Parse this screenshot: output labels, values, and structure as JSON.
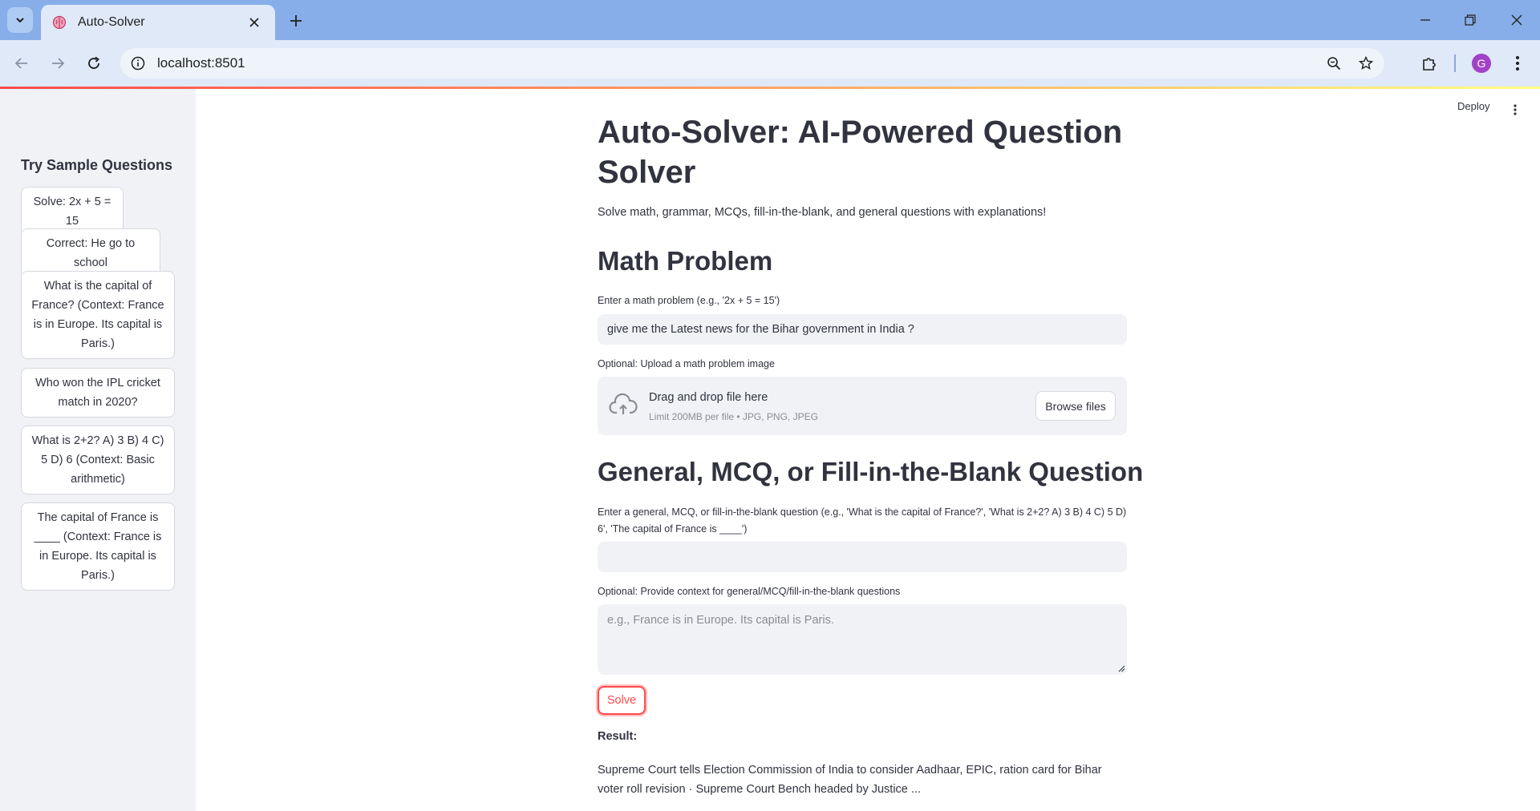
{
  "browser": {
    "tab_title": "Auto-Solver",
    "url": "localhost:8501",
    "profile_initial": "G"
  },
  "app": {
    "deploy_label": "Deploy",
    "sidebar": {
      "heading": "Try Sample Questions",
      "samples": [
        "Solve: 2x + 5 = 15",
        "Correct: He go to school",
        "What is the capital of France? (Context: France is in Europe. Its capital is Paris.)",
        "Who won the IPL cricket match in 2020?",
        "What is 2+2? A) 3 B) 4 C) 5 D) 6 (Context: Basic arithmetic)",
        "The capital of France is ____ (Context: France is in Europe. Its capital is Paris.)"
      ]
    },
    "title": "Auto-Solver: AI-Powered Question Solver",
    "subtitle": "Solve math, grammar, MCQs, fill-in-the-blank, and general questions with explanations!",
    "math": {
      "heading": "Math Problem",
      "input_label": "Enter a math problem (e.g., '2x + 5 = 15')",
      "input_value": "give me the Latest news for the Bihar government in India ?",
      "upload_label": "Optional: Upload a math problem image",
      "upload_title": "Drag and drop file here",
      "upload_limit": "Limit 200MB per file • JPG, PNG, JPEG",
      "browse_label": "Browse files"
    },
    "general": {
      "heading": "General, MCQ, or Fill-in-the-Blank Question",
      "input_label": "Enter a general, MCQ, or fill-in-the-blank question (e.g., 'What is the capital of France?', 'What is 2+2? A) 3 B) 4 C) 5 D) 6', 'The capital of France is ____')",
      "input_value": "",
      "context_label": "Optional: Provide context for general/MCQ/fill-in-the-blank questions",
      "context_placeholder": "e.g., France is in Europe. Its capital is Paris."
    },
    "solve_label": "Solve",
    "result_label": "Result:",
    "result_text": "Supreme Court tells Election Commission of India to consider Aadhaar, EPIC, ration card for Bihar voter roll revision · Supreme Court Bench headed by Justice ..."
  },
  "colors": {
    "accent": "#ff4b4b",
    "tabbar": "#87aee8",
    "toolbar": "#dfe9f8",
    "sidebar": "#f0f2f6"
  }
}
